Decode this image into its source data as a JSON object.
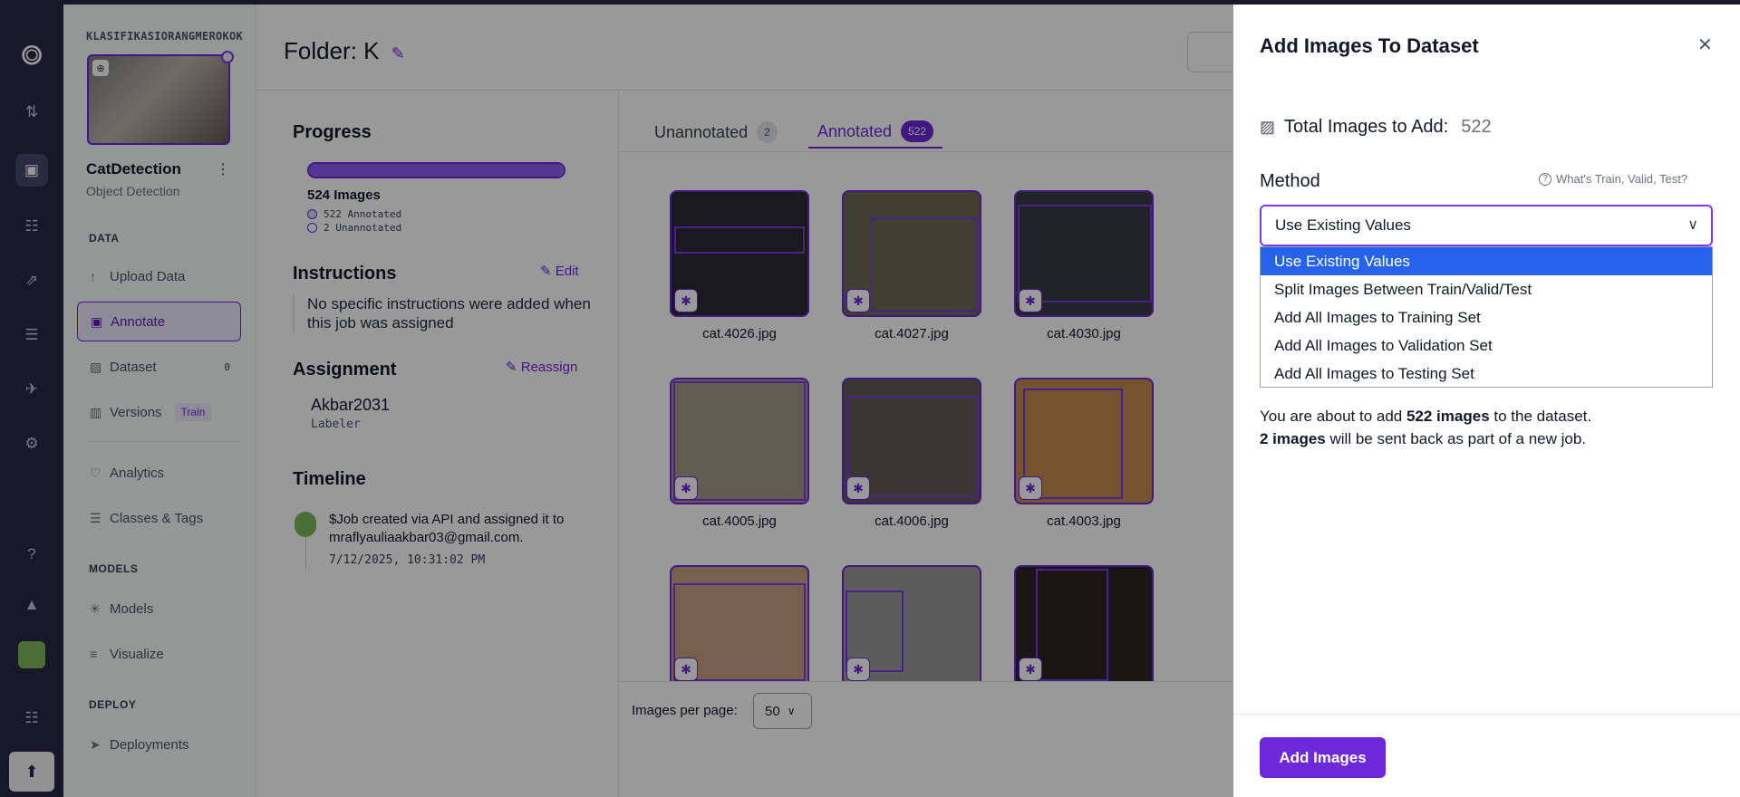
{
  "workspace": {
    "name": "KLASIFIKASIORANGMEROKOK"
  },
  "project": {
    "name": "CatDetection",
    "type": "Object Detection"
  },
  "sidebar": {
    "data_heading": "DATA",
    "models_heading": "MODELS",
    "deploy_heading": "DEPLOY",
    "items": [
      {
        "label": "Upload Data",
        "icon": "arrow-up-icon"
      },
      {
        "label": "Annotate",
        "icon": "annotate-icon"
      },
      {
        "label": "Dataset",
        "icon": "image-icon",
        "badge": "0"
      },
      {
        "label": "Versions",
        "icon": "versions-icon",
        "tag": "Train"
      },
      {
        "label": "Analytics",
        "icon": "heart-pulse-icon"
      },
      {
        "label": "Classes & Tags",
        "icon": "list-icon"
      },
      {
        "label": "Models",
        "icon": "models-icon"
      },
      {
        "label": "Visualize",
        "icon": "chart-icon"
      },
      {
        "label": "Deployments",
        "icon": "rocket-icon"
      }
    ]
  },
  "header": {
    "folder_title": "Folder: K"
  },
  "job": {
    "progress_heading": "Progress",
    "progress_annotated_fraction": 0.996,
    "images_count": "524 Images",
    "annotated_legend": "522 Annotated",
    "unannotated_legend": "2 Unannotated",
    "instructions_heading": "Instructions",
    "edit_label": "Edit",
    "instructions_text": "No specific instructions were added when this job was assigned",
    "assignment_heading": "Assignment",
    "reassign_label": "Reassign",
    "assignee": "Akbar2031",
    "assignee_role": "Labeler",
    "timeline_heading": "Timeline",
    "timeline_text": "$Job created via API and assigned it to mraflyauliaakbar03@gmail.com.",
    "timeline_time": "7/12/2025, 10:31:02 PM"
  },
  "tabs": [
    {
      "label": "Unannotated",
      "count": "2"
    },
    {
      "label": "Annotated",
      "count": "522"
    }
  ],
  "images": [
    {
      "name": "cat.4026.jpg",
      "color": "#2a2a33"
    },
    {
      "name": "cat.4027.jpg",
      "color": "#6b6a52"
    },
    {
      "name": "cat.4030.jpg",
      "color": "#3a3b45"
    },
    {
      "name": "cat.4005.jpg",
      "color": "#a39a8a"
    },
    {
      "name": "cat.4006.jpg",
      "color": "#5f5a55"
    },
    {
      "name": "cat.4003.jpg",
      "color": "#c48a4e"
    },
    {
      "name": "",
      "color": "#c9a080"
    },
    {
      "name": "",
      "color": "#9a9a9a"
    },
    {
      "name": "",
      "color": "#2a2624"
    }
  ],
  "pager": {
    "label": "Images per page:",
    "value": "50"
  },
  "drawer": {
    "title": "Add Images To Dataset",
    "total_label": "Total Images to Add:",
    "total_value": "522",
    "method_label": "Method",
    "help_label": "What's Train, Valid, Test?",
    "selected": "Use Existing Values",
    "options": [
      "Use Existing Values",
      "Split Images Between Train/Valid/Test",
      "Add All Images to Training Set",
      "Add All Images to Validation Set",
      "Add All Images to Testing Set"
    ],
    "info_line1_prefix": "You are about to add ",
    "info_line1_bold": "522 images",
    "info_line1_suffix": " to the dataset.",
    "info_line2_bold": "2 images",
    "info_line2_suffix": " will be sent back as part of a new job.",
    "button_label": "Add Images"
  },
  "colors": {
    "accent": "#6d28d9",
    "rail": "#2b2847",
    "selected_option": "#2563eb"
  }
}
